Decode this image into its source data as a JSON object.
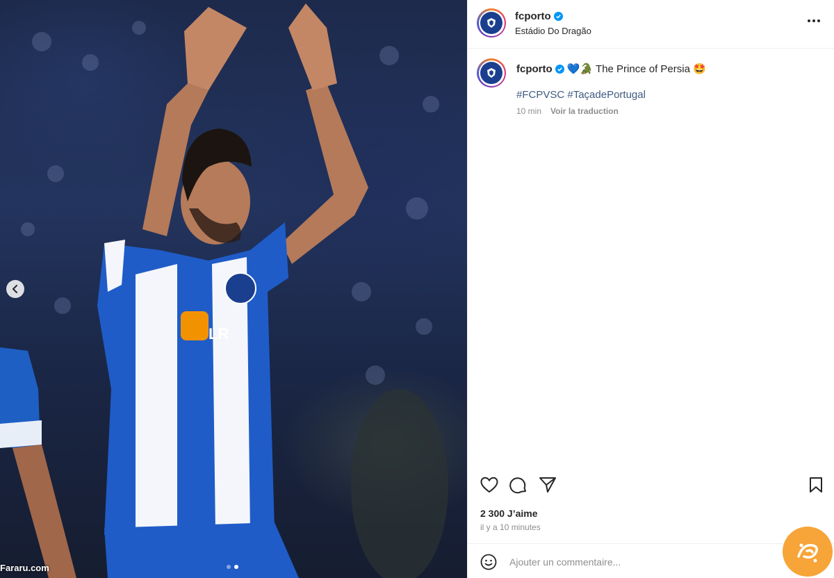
{
  "media": {
    "watermark": "Fararu.com",
    "carousel": {
      "slide_count": 2,
      "active_index": 1
    },
    "prev_icon": "chevron-left-icon"
  },
  "post": {
    "header": {
      "username": "fcporto",
      "location": "Estádio Do Dragão",
      "more_icon": "more-horizontal-icon"
    },
    "caption": {
      "username": "fcporto",
      "emojis_before": "💙🐊",
      "text": "The Prince of Persia",
      "emoji_after": "🤩",
      "hashtags": [
        "#FCPVSC",
        "#TaçadePortugal"
      ],
      "age": "10 min",
      "translate_label": "Voir la traduction"
    },
    "actions": {
      "like_icon": "heart-icon",
      "comment_icon": "comment-icon",
      "share_icon": "share-icon",
      "save_icon": "bookmark-icon"
    },
    "likes_label": "2 300 J’aime",
    "timestamp": "il y a 10 minutes",
    "comment": {
      "placeholder": "Ajouter un commentaire...",
      "emoji_icon": "smiley-icon"
    }
  },
  "colors": {
    "verified": "#0095f6",
    "hashtag": "#3d5a80",
    "secondary_text": "#8e8e8e",
    "porto_blue": "#1b3f8f"
  }
}
